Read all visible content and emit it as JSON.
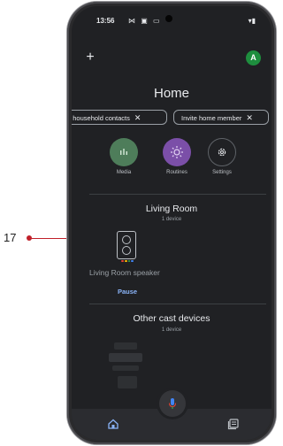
{
  "annotation": {
    "number": "17"
  },
  "status_bar": {
    "time": "13:56",
    "icons": "⋈ ▣ ▭",
    "right_icons": "▾▮"
  },
  "top_bar": {
    "add_label": "+",
    "avatar_letter": "A"
  },
  "page": {
    "title": "Home"
  },
  "chips": [
    {
      "label": "p household contacts",
      "close": "✕"
    },
    {
      "label": "Invite home member",
      "close": "✕"
    }
  ],
  "actions": [
    {
      "label": "Media",
      "icon": "equalizer-icon",
      "color": "#4e7d5a"
    },
    {
      "label": "Routines",
      "icon": "sun-icon",
      "color": "#7b4fa8"
    },
    {
      "label": "Settings",
      "icon": "gear-icon",
      "color": "#202124"
    }
  ],
  "living_room": {
    "title": "Living Room",
    "subtitle": "1 device",
    "device_name": "Living Room speaker",
    "device_action": "Pause"
  },
  "other_devices": {
    "title": "Other cast devices",
    "subtitle": "1 device"
  },
  "colors": {
    "background": "#202124",
    "accent_blue": "#8ab4f8",
    "avatar_green": "#1e8e3e"
  }
}
